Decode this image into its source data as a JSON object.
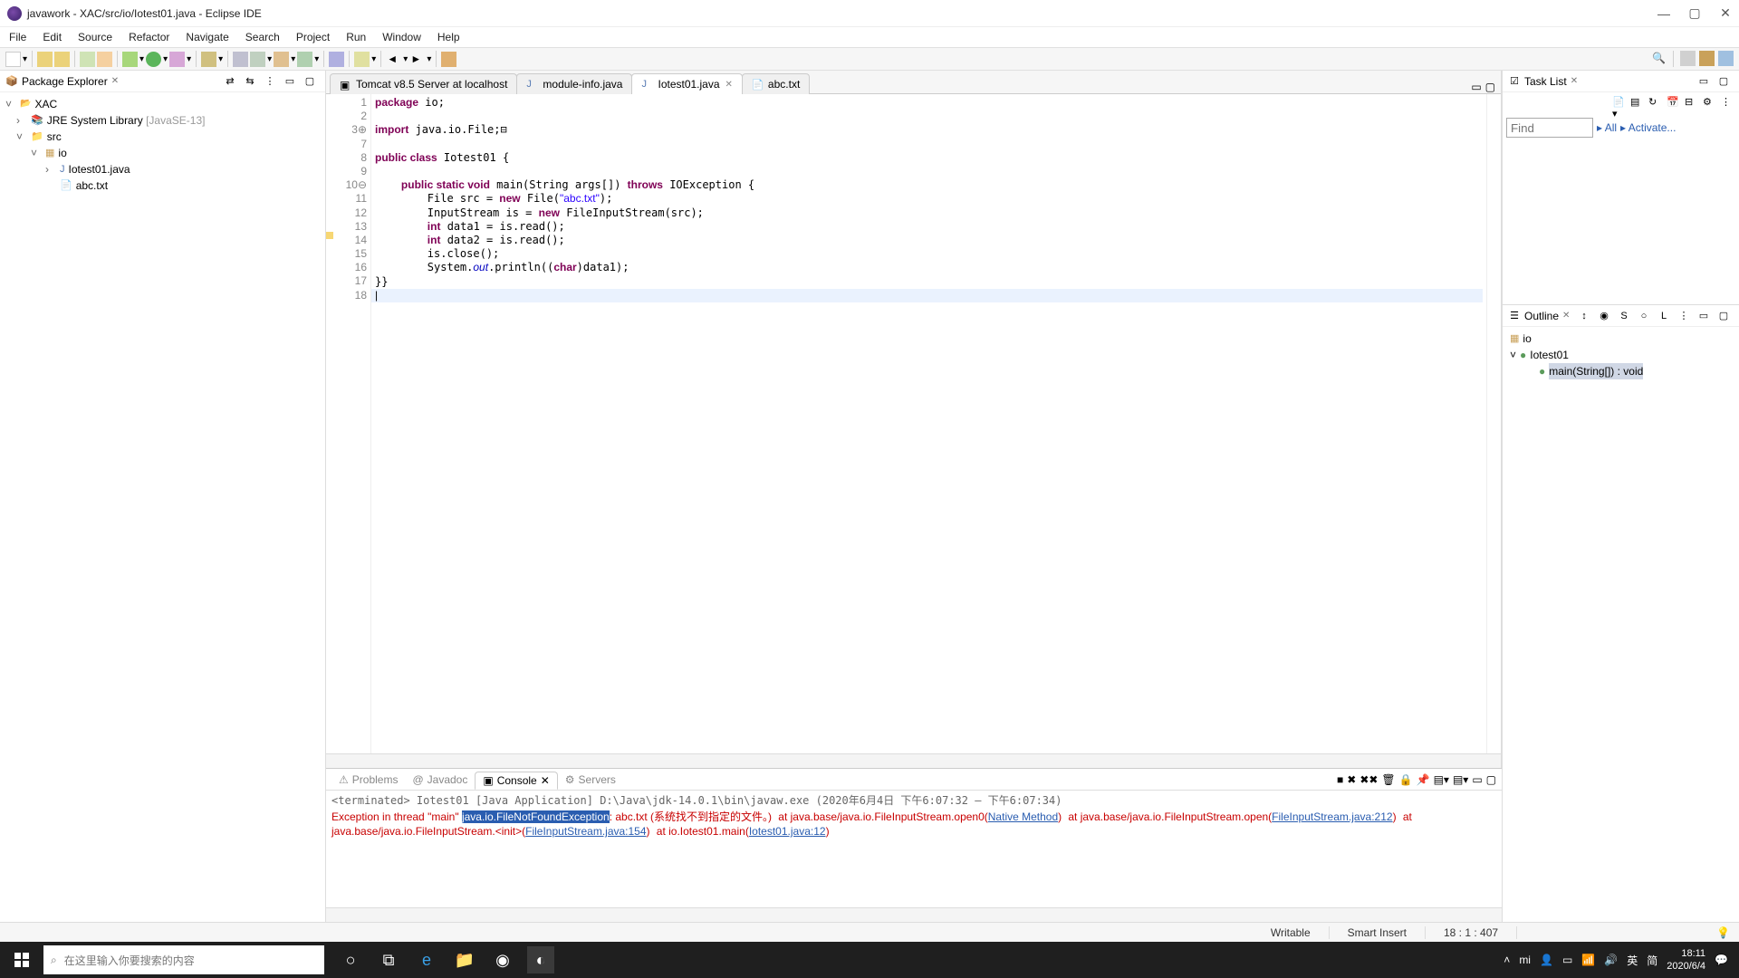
{
  "window": {
    "title": "javawork - XAC/src/io/Iotest01.java - Eclipse IDE"
  },
  "menu": [
    "File",
    "Edit",
    "Source",
    "Refactor",
    "Navigate",
    "Search",
    "Project",
    "Run",
    "Window",
    "Help"
  ],
  "package_explorer": {
    "title": "Package Explorer",
    "project": "XAC",
    "jre": "JRE System Library",
    "jre_dec": "[JavaSE-13]",
    "src": "src",
    "pkg": "io",
    "file1": "Iotest01.java",
    "file2": "abc.txt"
  },
  "editor_tabs": [
    "Tomcat v8.5 Server at localhost",
    "module-info.java",
    "Iotest01.java",
    "abc.txt"
  ],
  "code_lines": {
    "1": "package io;",
    "2": "",
    "3": "import java.io.File;⊟",
    "7": "",
    "8": "public class Iotest01 {",
    "9": "",
    "10": "    public static void main(String args[]) throws IOException {",
    "11": "        File src = new File(\"abc.txt\");",
    "12": "        InputStream is = new FileInputStream(src);",
    "13": "        int data1 = is.read();",
    "14": "        int data2 = is.read();",
    "15": "        is.close();",
    "16": "        System.out.println((char)data1);",
    "17": "}}",
    "18": ""
  },
  "gutter": [
    "1",
    "2",
    "3",
    "7",
    "8",
    "9",
    "10",
    "11",
    "12",
    "13",
    "14",
    "15",
    "16",
    "17",
    "18"
  ],
  "task_list": {
    "title": "Task List",
    "find_placeholder": "Find",
    "all": "All",
    "activate": "Activate..."
  },
  "outline": {
    "title": "Outline",
    "pkg": "io",
    "cls": "Iotest01",
    "method": "main(String[]) : void"
  },
  "bottom_tabs": [
    "Problems",
    "Javadoc",
    "Console",
    "Servers"
  ],
  "console": {
    "header": "<terminated> Iotest01 [Java Application] D:\\Java\\jdk-14.0.1\\bin\\javaw.exe  (2020年6月4日 下午6:07:32 – 下午6:07:34)",
    "l1a": "Exception in thread \"main\" ",
    "l1b": "java.io.FileNotFoundException",
    "l1c": ": abc.txt (系统找不到指定的文件。)",
    "l2a": "        at java.base/java.io.FileInputStream.open0(",
    "l2b": "Native Method",
    "l2c": ")",
    "l3a": "        at java.base/java.io.FileInputStream.open(",
    "l3b": "FileInputStream.java:212",
    "l3c": ")",
    "l4a": "        at java.base/java.io.FileInputStream.<init>(",
    "l4b": "FileInputStream.java:154",
    "l4c": ")",
    "l5a": "        at io.Iotest01.main(",
    "l5b": "Iotest01.java:12",
    "l5c": ")"
  },
  "status": {
    "writable": "Writable",
    "insert": "Smart Insert",
    "pos": "18 : 1 : 407"
  },
  "taskbar": {
    "search_placeholder": "在这里输入你要搜索的内容",
    "ime_lang": "英",
    "ime_mode": "简",
    "time": "18:11",
    "date": "2020/6/4"
  }
}
